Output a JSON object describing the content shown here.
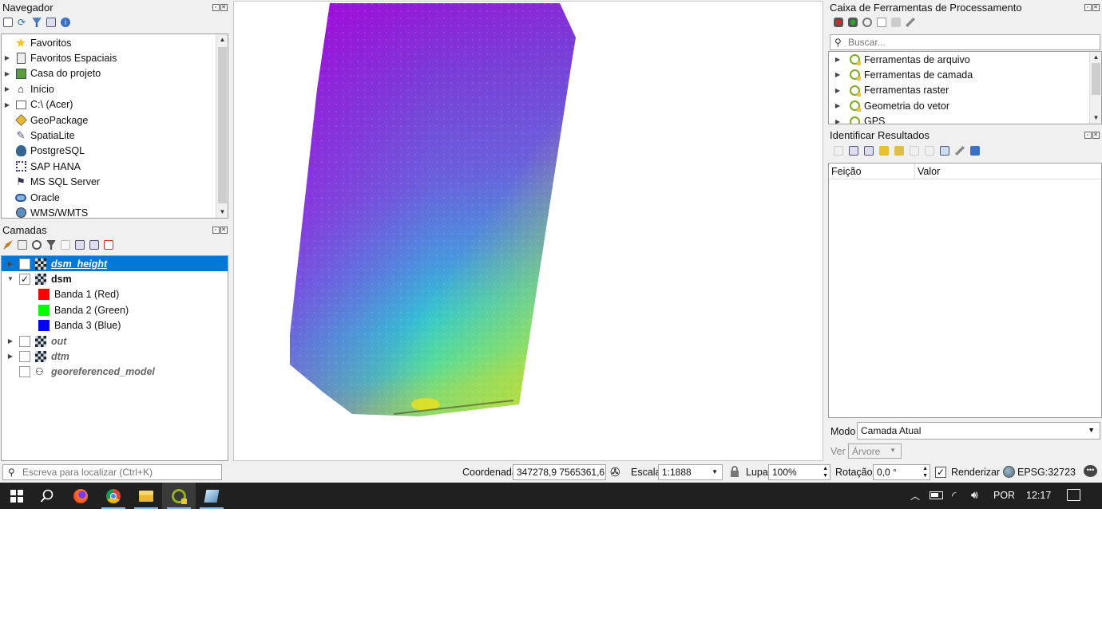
{
  "navigator": {
    "title": "Navegador",
    "items": [
      {
        "label": "Favoritos",
        "icon": "star-icon",
        "expandable": false
      },
      {
        "label": "Favoritos Espaciais",
        "icon": "spatial-bookmarks-icon",
        "expandable": true
      },
      {
        "label": "Casa do projeto",
        "icon": "project-home-icon",
        "expandable": true
      },
      {
        "label": "Início",
        "icon": "home-icon",
        "expandable": true
      },
      {
        "label": "C:\\ (Acer)",
        "icon": "drive-icon",
        "expandable": true
      },
      {
        "label": "GeoPackage",
        "icon": "geopackage-icon",
        "expandable": false
      },
      {
        "label": "SpatiaLite",
        "icon": "spatialite-icon",
        "expandable": false
      },
      {
        "label": "PostgreSQL",
        "icon": "postgresql-icon",
        "expandable": false
      },
      {
        "label": "SAP HANA",
        "icon": "sap-hana-icon",
        "expandable": false
      },
      {
        "label": "MS SQL Server",
        "icon": "mssql-icon",
        "expandable": false
      },
      {
        "label": "Oracle",
        "icon": "oracle-icon",
        "expandable": false
      },
      {
        "label": "WMS/WMTS",
        "icon": "wms-icon",
        "expandable": false
      }
    ]
  },
  "layers": {
    "title": "Camadas",
    "items": [
      {
        "label": "dsm_height",
        "checked": false,
        "selected": true,
        "style": "italic-underline"
      },
      {
        "label": "dsm",
        "checked": true,
        "selected": false,
        "style": "bold"
      },
      {
        "label": "Banda 1 (Red)",
        "swatch": "#ff0000"
      },
      {
        "label": "Banda 2 (Green)",
        "swatch": "#00ff00"
      },
      {
        "label": "Banda 3 (Blue)",
        "swatch": "#0000ff"
      },
      {
        "label": "out",
        "checked": false,
        "style": "italic"
      },
      {
        "label": "dtm",
        "checked": false,
        "style": "italic"
      },
      {
        "label": "georeferenced_model",
        "checked": false,
        "style": "italic"
      }
    ]
  },
  "processing": {
    "title": "Caixa de Ferramentas de Processamento",
    "search_placeholder": "Buscar...",
    "items": [
      "Ferramentas de arquivo",
      "Ferramentas de camada",
      "Ferramentas raster",
      "Geometria do vetor",
      "GPS"
    ]
  },
  "identify": {
    "title": "Identificar Resultados",
    "col_feature": "Feição",
    "col_value": "Valor",
    "mode_label": "Modo",
    "mode_value": "Camada Atual",
    "view_label": "Ver",
    "view_value": "Árvore"
  },
  "statusbar": {
    "locator_placeholder": "Escreva para localizar (Ctrl+K)",
    "coord_label": "Coordenada",
    "coord_value": "347278,9 7565361,6",
    "scale_label": "Escala",
    "scale_value": "1:1888",
    "magnifier_label": "Lupa",
    "magnifier_value": "100%",
    "rotation_label": "Rotação",
    "rotation_value": "0,0 °",
    "render_label": "Renderizar",
    "crs": "EPSG:32723"
  },
  "taskbar": {
    "language": "POR",
    "time": "12:17"
  },
  "colors": {
    "selection": "#0078d7",
    "accent": "#8cb4e8"
  }
}
